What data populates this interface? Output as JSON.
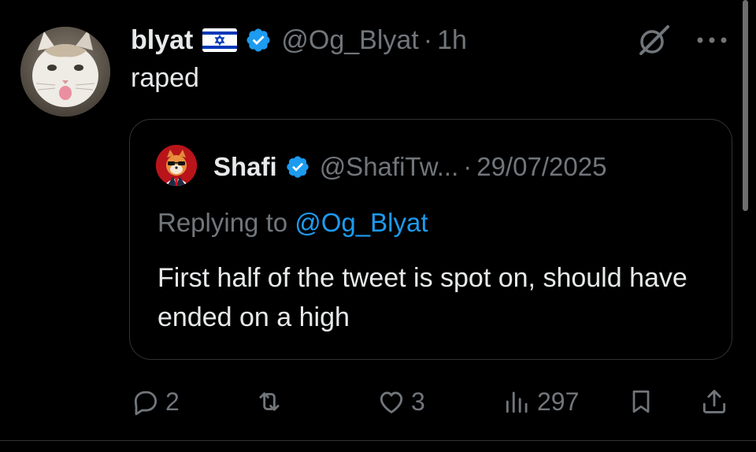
{
  "tweet": {
    "author": {
      "display_name": "blyat",
      "flag": "israel-flag",
      "verified": true,
      "handle": "@Og_Blyat",
      "separator": "·",
      "time": "1h"
    },
    "text": "raped",
    "menu_icons": [
      "grok-icon",
      "more-icon"
    ]
  },
  "quote": {
    "author": {
      "display_name": "Shafi",
      "verified": true,
      "handle": "@ShafiTw...",
      "separator": "·",
      "date": "29/07/2025"
    },
    "replying_prefix": "Replying to ",
    "replying_to": "@Og_Blyat",
    "text": "First half of the tweet is spot on, should have ended on a high"
  },
  "actions": {
    "replies": "2",
    "reposts": "",
    "likes": "3",
    "views": "297"
  },
  "colors": {
    "background": "#000000",
    "text_primary": "#e7e9ea",
    "text_secondary": "#71767b",
    "accent": "#1d9bf0",
    "border": "#2f3336"
  }
}
